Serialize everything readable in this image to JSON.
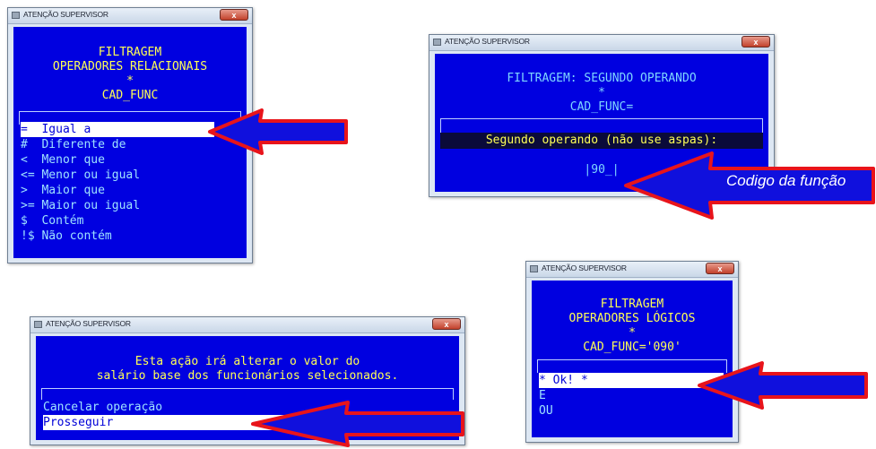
{
  "colors": {
    "screen_bg": "#0000e0",
    "title_text": "#ffff55",
    "menu_text": "#9fe3ff",
    "arrow_fill": "#1010dd",
    "arrow_stroke": "#e8141b"
  },
  "window1": {
    "title": "ATENÇÃO SUPERVISOR",
    "close_label": "x",
    "lines": [
      "FILTRAGEM",
      "OPERADORES RELACIONAIS",
      "*",
      "CAD_FUNC"
    ],
    "items": [
      "=  Igual a",
      "#  Diferente de",
      "<  Menor que",
      "<= Menor ou igual",
      ">  Maior que",
      ">= Maior ou igual",
      "$  Contém",
      "!$ Não contém"
    ],
    "selected_index": 0
  },
  "window2": {
    "title": "ATENÇÃO SUPERVISOR",
    "close_label": "x",
    "lines": [
      "FILTRAGEM: SEGUNDO OPERANDO",
      "*",
      "CAD_FUNC="
    ],
    "prompt": "Segundo operando (não use aspas):",
    "input_value": "|90_|",
    "callout": "Codigo da função"
  },
  "window3": {
    "title": "ATENÇÃO SUPERVISOR",
    "close_label": "x",
    "lines": [
      "Esta ação irá alterar o valor do",
      "salário base dos funcionários selecionados."
    ],
    "items": [
      "Cancelar operação",
      "Prosseguir"
    ],
    "selected_index": 1
  },
  "window4": {
    "title": "ATENÇÃO SUPERVISOR",
    "close_label": "x",
    "lines": [
      "FILTRAGEM",
      "OPERADORES LÓGICOS",
      "*",
      "CAD_FUNC='090'"
    ],
    "items": [
      "* Ok! *",
      "E",
      "OU"
    ],
    "selected_index": 0
  }
}
